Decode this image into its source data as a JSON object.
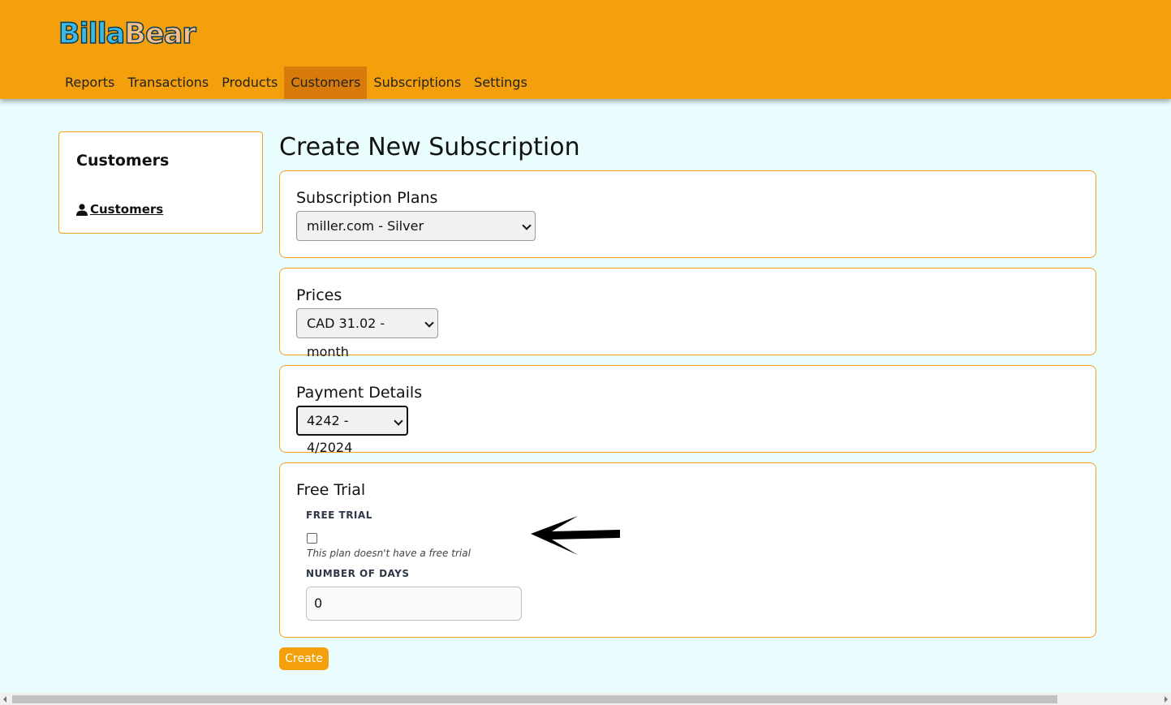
{
  "header": {
    "logo_part1": "Billa",
    "logo_part2": "Bear",
    "nav": [
      {
        "label": "Reports"
      },
      {
        "label": "Transactions"
      },
      {
        "label": "Products"
      },
      {
        "label": "Customers",
        "active": true
      },
      {
        "label": "Subscriptions"
      },
      {
        "label": "Settings"
      }
    ]
  },
  "sidebar": {
    "title": "Customers",
    "link": "Customers",
    "link_icon": "user-icon"
  },
  "main": {
    "title": "Create New Subscription",
    "subscription_plans": {
      "label": "Subscription Plans",
      "selected": "miller.com - Silver"
    },
    "prices": {
      "label": "Prices",
      "selected": "CAD 31.02 - month"
    },
    "payment_details": {
      "label": "Payment Details",
      "selected": "4242 - 4/2024"
    },
    "free_trial": {
      "section_label": "Free Trial",
      "checkbox_label": "FREE TRIAL",
      "checked": false,
      "hint": "This plan doesn't have a free trial",
      "days_label": "NUMBER OF DAYS",
      "days_value": "0"
    },
    "create_label": "Create"
  },
  "colors": {
    "header": "#f4a00c",
    "active_nav": "#d97b0b",
    "page_bg": "#e9fdfe",
    "card_border": "#f0a020",
    "button": "#f4a00c"
  }
}
